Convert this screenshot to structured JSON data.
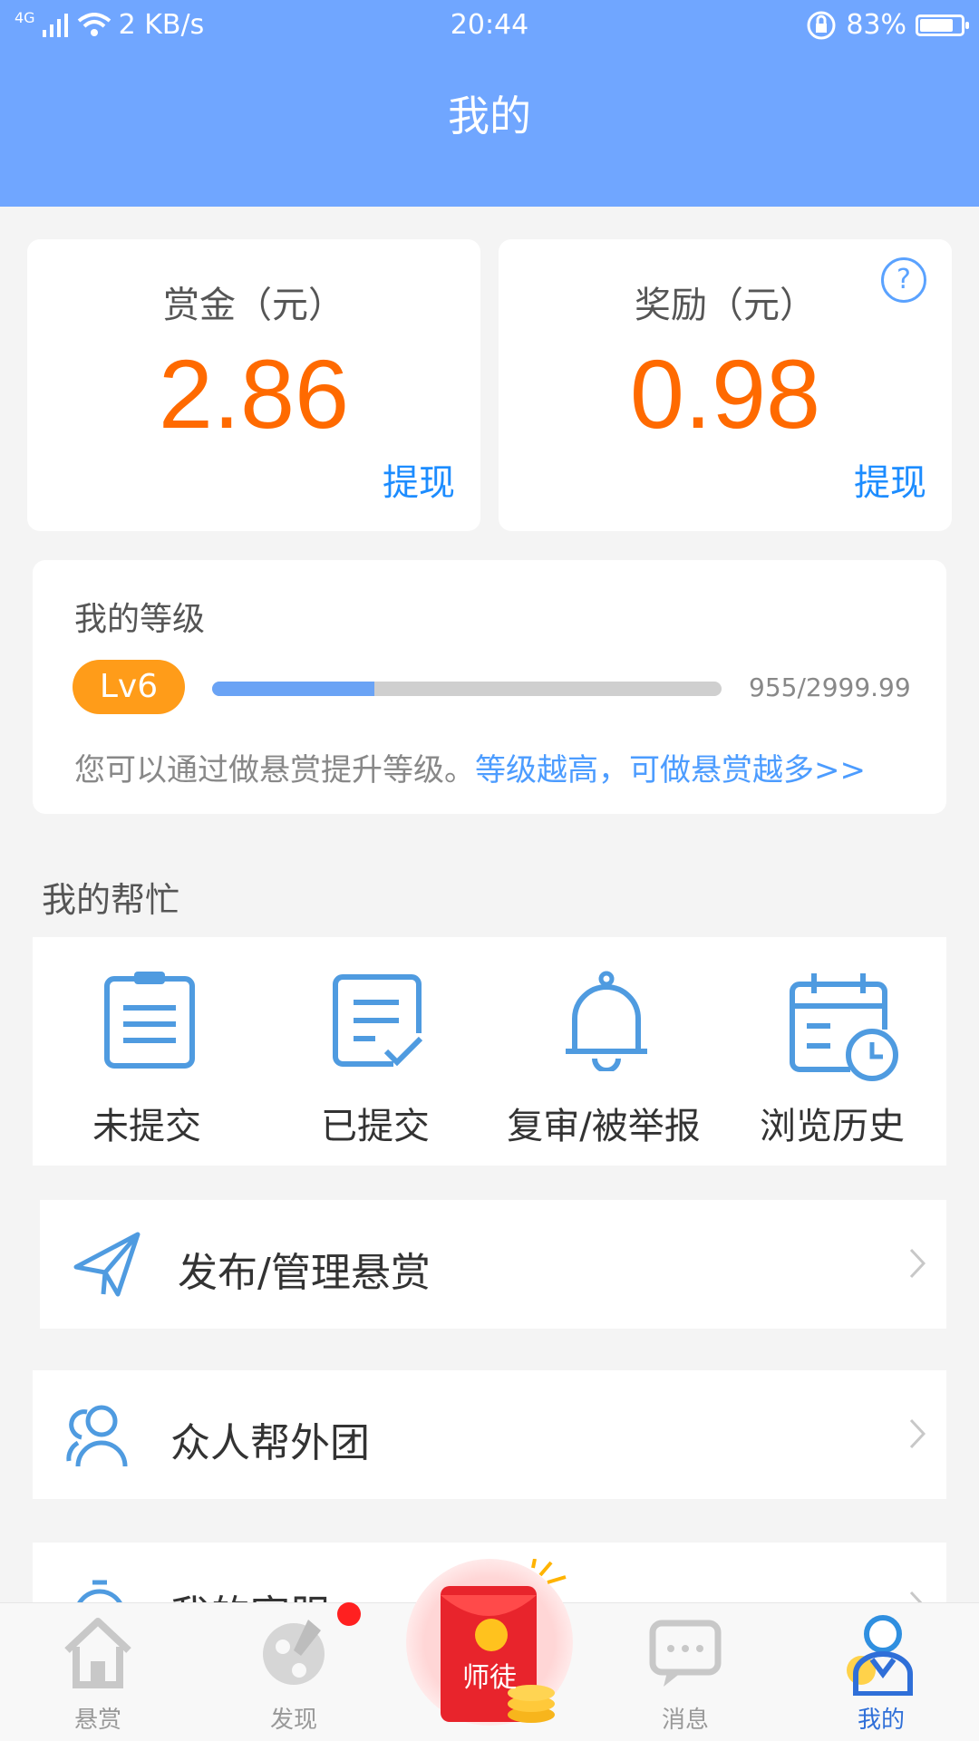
{
  "status_bar": {
    "signal": "4G",
    "speed": "2 KB/s",
    "time": "20:44",
    "battery": "83%",
    "battery_level": 0.83
  },
  "header": {
    "title": "我的"
  },
  "bounty": {
    "label": "赏金（元）",
    "value": "2.86",
    "action": "提现"
  },
  "reward": {
    "label": "奖励（元）",
    "value": "0.98",
    "action": "提现",
    "help": "?"
  },
  "level": {
    "title": "我的等级",
    "badge": "Lv6",
    "progress_text": "955/2999.99",
    "progress_fraction": 0.3184,
    "tip": "您可以通过做悬赏提升等级。",
    "tip_link": "等级越高，可做悬赏越多>>"
  },
  "help_section": {
    "title": "我的帮忙",
    "items": [
      {
        "label": "未提交",
        "icon": "clipboard-icon"
      },
      {
        "label": "已提交",
        "icon": "document-check-icon"
      },
      {
        "label": "复审/被举报",
        "icon": "bell-icon"
      },
      {
        "label": "浏览历史",
        "icon": "calendar-clock-icon"
      }
    ]
  },
  "menu": [
    {
      "label": "发布/管理悬赏",
      "icon": "paper-plane-icon"
    },
    {
      "label": "众人帮外团",
      "icon": "users-icon"
    },
    {
      "label": "我的客服",
      "icon": "alarm-clock-icon"
    }
  ],
  "tabbar": {
    "items": [
      {
        "label": "悬赏",
        "icon": "home-icon"
      },
      {
        "label": "发现",
        "icon": "palette-icon"
      },
      {
        "label": "师徒",
        "icon": "red-envelope-icon"
      },
      {
        "label": "消息",
        "icon": "chat-icon"
      },
      {
        "label": "我的",
        "icon": "profile-icon"
      }
    ],
    "active_color": "#2f6fd8",
    "inactive_color": "#999999"
  },
  "colors": {
    "header": "#70a6ff",
    "amount": "#ff6a00",
    "link": "#1c8cff",
    "badge": "#ff9c19"
  }
}
